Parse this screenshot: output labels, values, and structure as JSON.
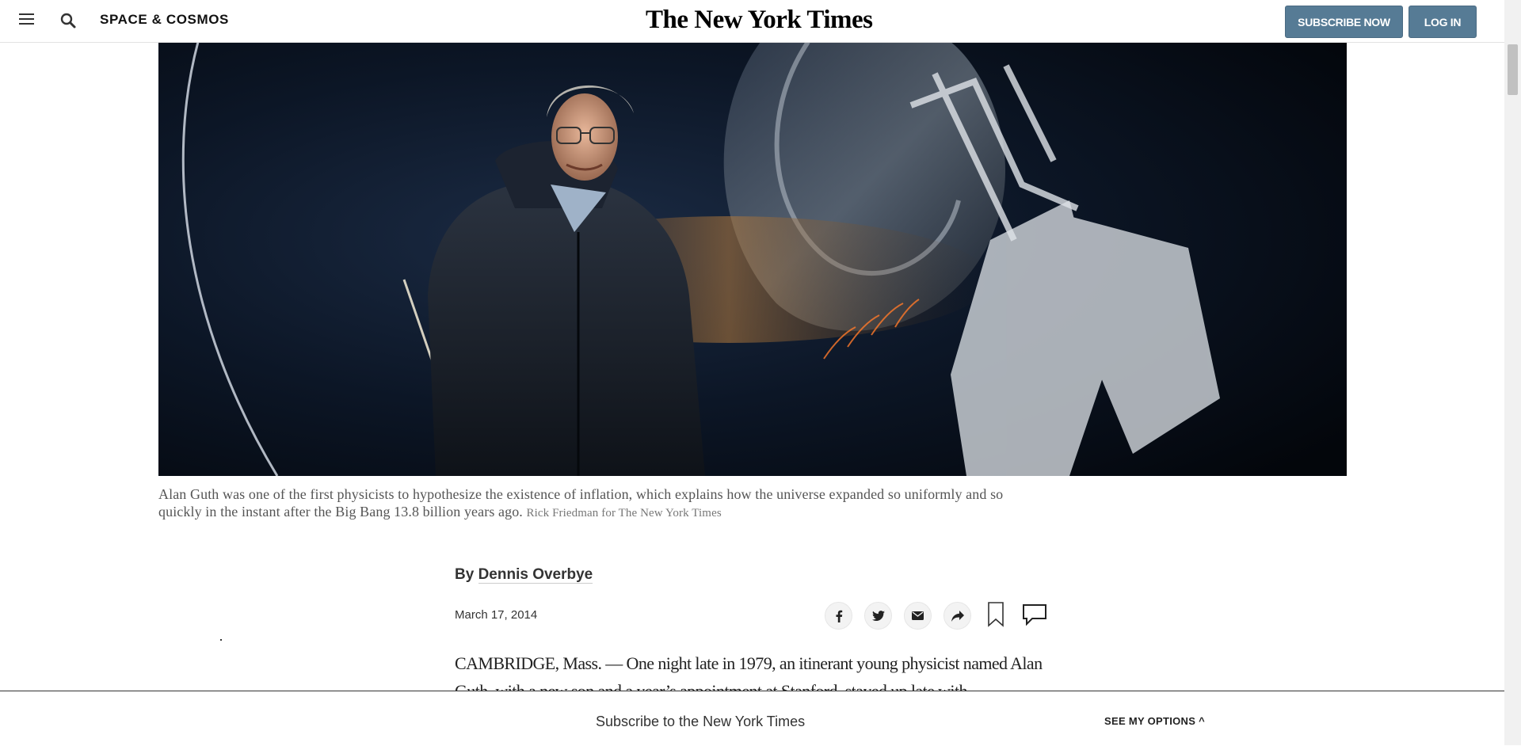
{
  "header": {
    "section": "SPACE & COSMOS",
    "logo": "The New York Times",
    "subscribe_label": "SUBSCRIBE NOW",
    "login_label": "LOG IN"
  },
  "hero": {
    "caption": "Alan Guth was one of the first physicists to hypothesize the existence of inflation, which explains how the universe expanded so uniformly and so quickly in the instant after the Big Bang 13.8 billion years ago.",
    "credit": "Rick Friedman for The New York Times"
  },
  "article": {
    "byline_prefix": "By",
    "author": "Dennis Overbye",
    "date": "March 17, 2014",
    "body": "CAMBRIDGE, Mass. — One night late in 1979, an itinerant young physicist named Alan Guth, with a new son and a year’s appointment at Stanford, stayed up late with"
  },
  "share": {
    "icons": [
      "facebook-icon",
      "twitter-icon",
      "email-icon",
      "share-icon",
      "bookmark-icon",
      "comment-icon"
    ]
  },
  "footer": {
    "text": "Subscribe to the New York Times",
    "options_label": "SEE MY OPTIONS ^"
  },
  "colors": {
    "button_bg": "#567b95",
    "hero_bg": "#060b13"
  }
}
